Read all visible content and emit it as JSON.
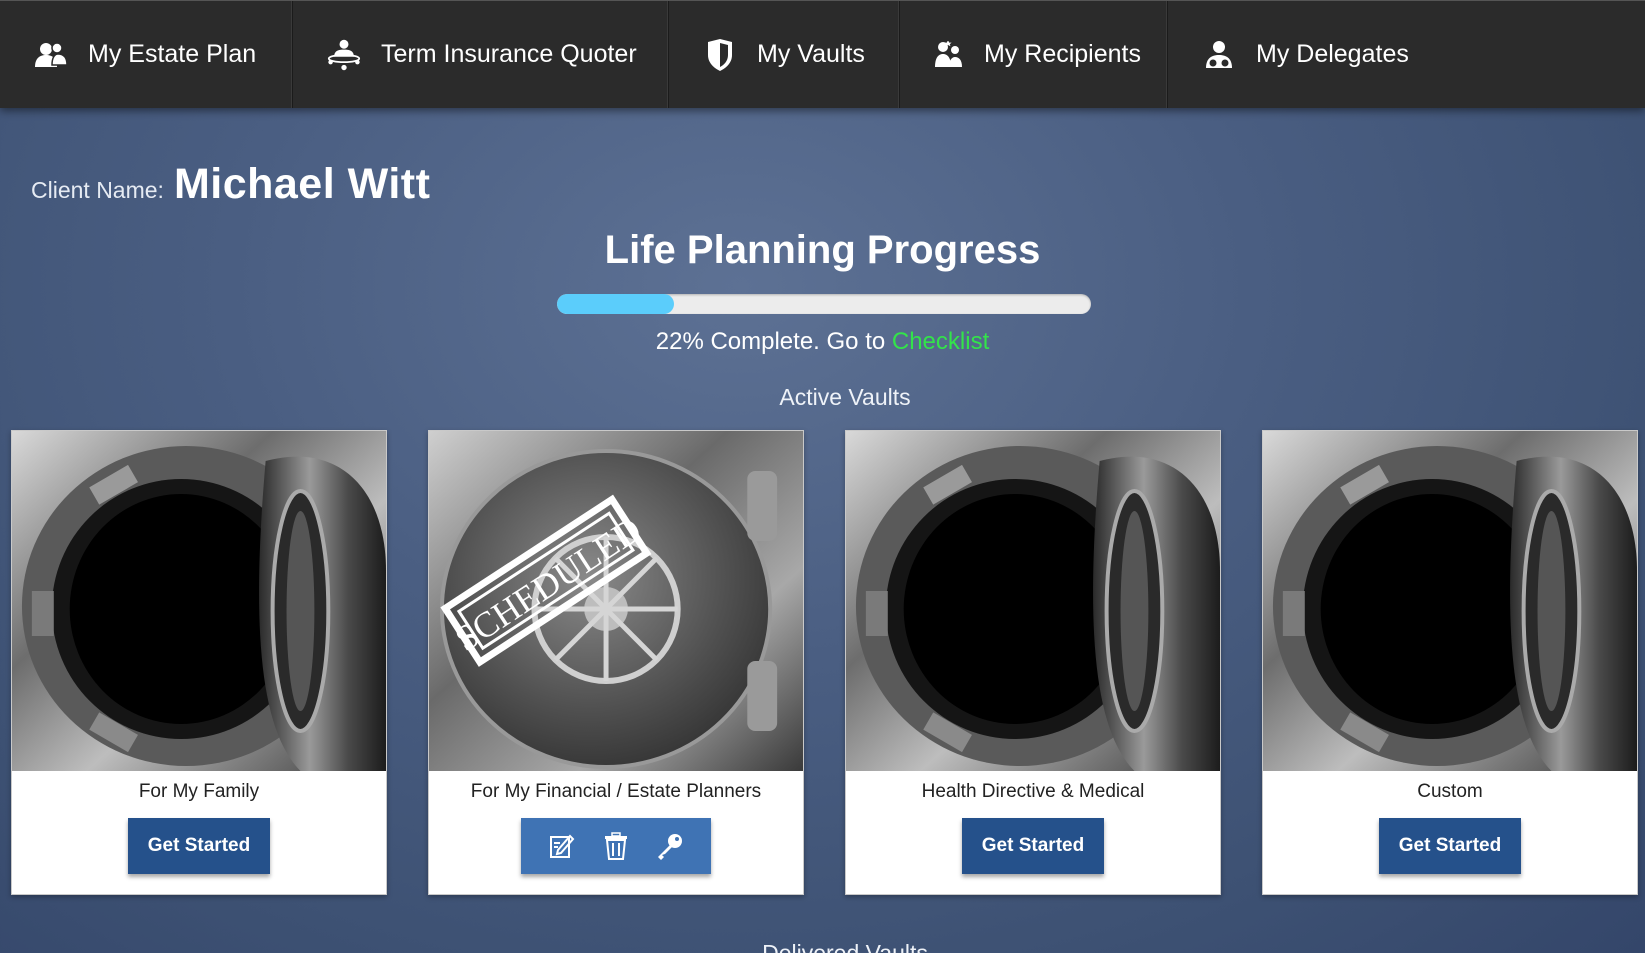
{
  "nav": {
    "items": [
      {
        "label": "My Estate Plan",
        "icon": "users-icon"
      },
      {
        "label": "Term Insurance Quoter",
        "icon": "insurance-icon"
      },
      {
        "label": "My Vaults",
        "icon": "shield-icon"
      },
      {
        "label": "My Recipients",
        "icon": "recipients-icon"
      },
      {
        "label": "My Delegates",
        "icon": "delegates-icon"
      }
    ]
  },
  "client": {
    "label": "Client Name:",
    "name": "Michael Witt"
  },
  "progress": {
    "title": "Life Planning Progress",
    "percent": 22,
    "text": "22% Complete. Go to",
    "link_label": "Checklist",
    "fill_color": "#5bcdfb",
    "link_color": "#33e34a"
  },
  "active_vaults": {
    "title": "Active Vaults",
    "cards": [
      {
        "name": "For My Family",
        "button_label": "Get Started",
        "state": "open"
      },
      {
        "name": "For My Financial / Estate Planners",
        "stamp": "SCHEDULED",
        "state": "scheduled",
        "actions": [
          "edit-icon",
          "trash-icon",
          "key-icon"
        ]
      },
      {
        "name": "Health Directive & Medical",
        "button_label": "Get Started",
        "state": "open"
      },
      {
        "name": "Custom",
        "button_label": "Get Started",
        "state": "open"
      }
    ]
  },
  "delivered_vaults": {
    "title": "Delivered Vaults"
  },
  "colors": {
    "nav_bg": "#2b2b2b",
    "button_bg": "#25518b",
    "icon_bar_bg": "#3f73b4"
  }
}
